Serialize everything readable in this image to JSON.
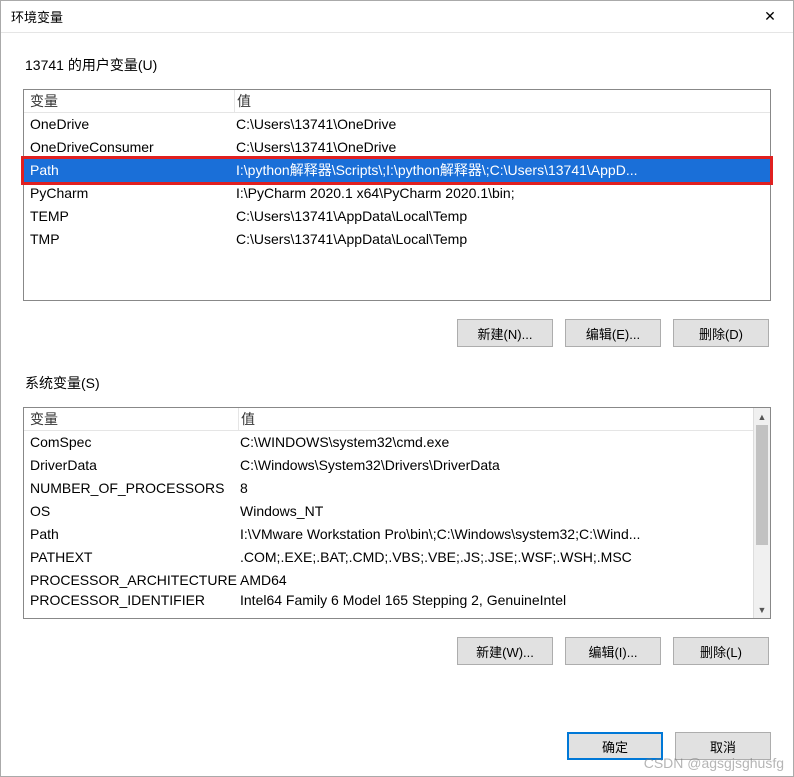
{
  "window": {
    "title": "环境变量",
    "close_glyph": "✕"
  },
  "user_section": {
    "label": "13741 的用户变量(U)",
    "columns": {
      "variable": "变量",
      "value": "值"
    },
    "rows": [
      {
        "variable": "OneDrive",
        "value": "C:\\Users\\13741\\OneDrive"
      },
      {
        "variable": "OneDriveConsumer",
        "value": "C:\\Users\\13741\\OneDrive"
      },
      {
        "variable": "Path",
        "value": "I:\\python解释器\\Scripts\\;I:\\python解释器\\;C:\\Users\\13741\\AppD..."
      },
      {
        "variable": "PyCharm",
        "value": "I:\\PyCharm 2020.1 x64\\PyCharm 2020.1\\bin;"
      },
      {
        "variable": "TEMP",
        "value": "C:\\Users\\13741\\AppData\\Local\\Temp"
      },
      {
        "variable": "TMP",
        "value": "C:\\Users\\13741\\AppData\\Local\\Temp"
      }
    ],
    "selected_index": 2,
    "buttons": {
      "new": "新建(N)...",
      "edit": "编辑(E)...",
      "delete": "删除(D)"
    }
  },
  "system_section": {
    "label": "系统变量(S)",
    "columns": {
      "variable": "变量",
      "value": "值"
    },
    "rows": [
      {
        "variable": "ComSpec",
        "value": "C:\\WINDOWS\\system32\\cmd.exe"
      },
      {
        "variable": "DriverData",
        "value": "C:\\Windows\\System32\\Drivers\\DriverData"
      },
      {
        "variable": "NUMBER_OF_PROCESSORS",
        "value": "8"
      },
      {
        "variable": "OS",
        "value": "Windows_NT"
      },
      {
        "variable": "Path",
        "value": "I:\\VMware Workstation Pro\\bin\\;C:\\Windows\\system32;C:\\Wind..."
      },
      {
        "variable": "PATHEXT",
        "value": ".COM;.EXE;.BAT;.CMD;.VBS;.VBE;.JS;.JSE;.WSF;.WSH;.MSC"
      },
      {
        "variable": "PROCESSOR_ARCHITECTURE",
        "value": "AMD64"
      }
    ],
    "partial_row": {
      "variable": "PROCESSOR_IDENTIFIER",
      "value": "Intel64 Family 6 Model 165 Stepping 2, GenuineIntel"
    },
    "buttons": {
      "new": "新建(W)...",
      "edit": "编辑(I)...",
      "delete": "删除(L)"
    }
  },
  "footer": {
    "ok": "确定",
    "cancel": "取消"
  },
  "watermark": "CSDN @agsgjsghusfg"
}
